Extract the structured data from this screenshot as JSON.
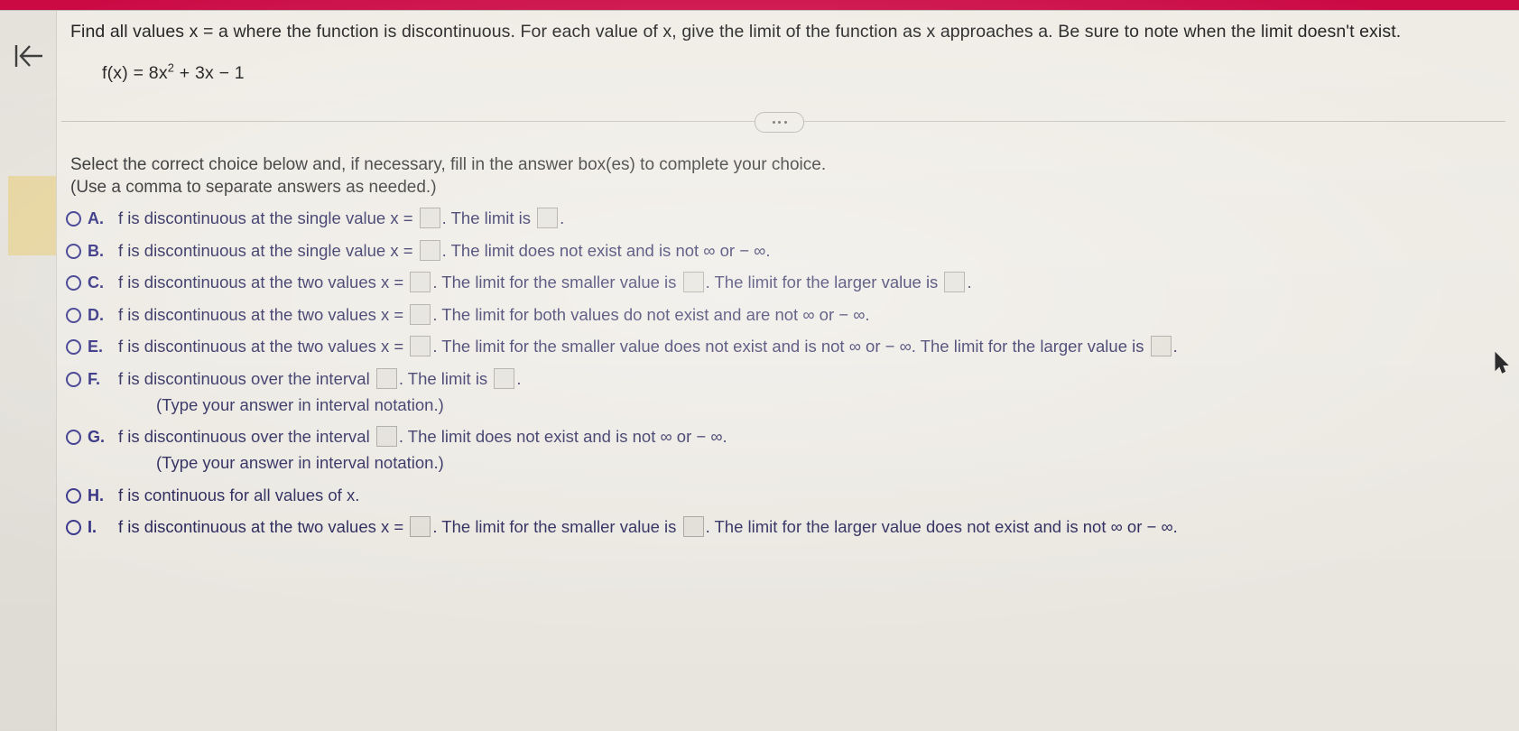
{
  "window": {
    "top_bar_color": "#cf0a45",
    "page_background": "#f4f1ea",
    "accent_text_color": "#211f5e"
  },
  "sidebar": {
    "collapse_icon_name": "collapse-panel-icon"
  },
  "problem": {
    "prompt": "Find all values x = a where the function is discontinuous. For each value of x, give the limit of the function as x approaches a. Be sure to note when the limit doesn't exist.",
    "formula_prefix": "f(x) = 8x",
    "formula_exponent": "2",
    "formula_suffix": " + 3x − 1"
  },
  "divider": {
    "dots_label": "•••"
  },
  "instruction": {
    "line1": "Select the correct choice below and, if necessary, fill in the answer box(es) to complete your choice.",
    "line2": "(Use a comma to separate answers as needed.)"
  },
  "choices": [
    {
      "letter": "A.",
      "segments": [
        {
          "type": "text",
          "value": "f is discontinuous at the single value x ="
        },
        {
          "type": "box",
          "value": ""
        },
        {
          "type": "text",
          "value": ". The limit is"
        },
        {
          "type": "box",
          "value": ""
        },
        {
          "type": "text",
          "value": "."
        }
      ],
      "note": ""
    },
    {
      "letter": "B.",
      "segments": [
        {
          "type": "text",
          "value": "f is discontinuous at the single value x ="
        },
        {
          "type": "box",
          "value": ""
        },
        {
          "type": "text",
          "value": ". The limit does not exist and is not ∞ or − ∞."
        }
      ],
      "note": ""
    },
    {
      "letter": "C.",
      "segments": [
        {
          "type": "text",
          "value": "f is discontinuous at the two values x ="
        },
        {
          "type": "box",
          "value": ""
        },
        {
          "type": "text",
          "value": ". The limit for the smaller value is"
        },
        {
          "type": "box",
          "value": ""
        },
        {
          "type": "text",
          "value": ". The limit for the larger value is"
        },
        {
          "type": "box",
          "value": ""
        },
        {
          "type": "text",
          "value": "."
        }
      ],
      "note": ""
    },
    {
      "letter": "D.",
      "segments": [
        {
          "type": "text",
          "value": "f is discontinuous at the two values x ="
        },
        {
          "type": "box",
          "value": ""
        },
        {
          "type": "text",
          "value": ". The limit for both values do not exist and are not ∞ or − ∞."
        }
      ],
      "note": ""
    },
    {
      "letter": "E.",
      "segments": [
        {
          "type": "text",
          "value": "f is discontinuous at the two values x ="
        },
        {
          "type": "box",
          "value": ""
        },
        {
          "type": "text",
          "value": ". The limit for the smaller value does not exist and is not ∞ or − ∞. The limit for the larger value is"
        },
        {
          "type": "box",
          "value": ""
        },
        {
          "type": "text",
          "value": "."
        }
      ],
      "note": ""
    },
    {
      "letter": "F.",
      "segments": [
        {
          "type": "text",
          "value": "f is discontinuous over the interval"
        },
        {
          "type": "box",
          "value": ""
        },
        {
          "type": "text",
          "value": ". The limit is"
        },
        {
          "type": "box",
          "value": ""
        },
        {
          "type": "text",
          "value": "."
        }
      ],
      "note": "(Type your answer in interval notation.)"
    },
    {
      "letter": "G.",
      "segments": [
        {
          "type": "text",
          "value": "f is discontinuous over the interval"
        },
        {
          "type": "box",
          "value": ""
        },
        {
          "type": "text",
          "value": ". The limit does not exist and is not ∞ or − ∞."
        }
      ],
      "note": "(Type your answer in interval notation.)"
    },
    {
      "letter": "H.",
      "segments": [
        {
          "type": "text",
          "value": "f is continuous for all values of x."
        }
      ],
      "note": ""
    },
    {
      "letter": "I.",
      "segments": [
        {
          "type": "text",
          "value": "f is discontinuous at the two values x ="
        },
        {
          "type": "box",
          "value": ""
        },
        {
          "type": "text",
          "value": ". The limit for the smaller value is"
        },
        {
          "type": "box",
          "value": ""
        },
        {
          "type": "text",
          "value": ". The limit for the larger value does not exist and is not ∞ or − ∞."
        }
      ],
      "note": ""
    }
  ],
  "cursor": {
    "name": "mouse-pointer"
  }
}
